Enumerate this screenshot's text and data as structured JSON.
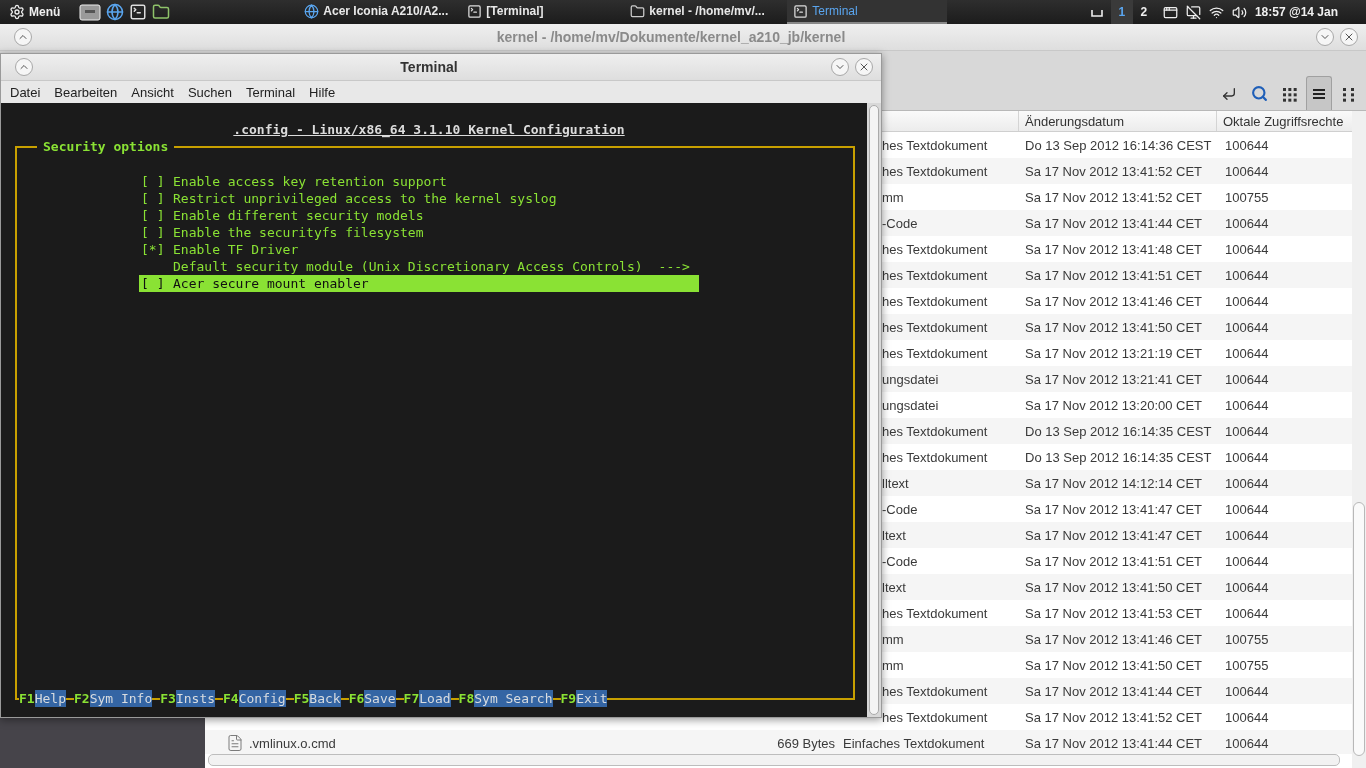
{
  "top_panel": {
    "menu_label": "Menü",
    "tasks": [
      {
        "kind": "browser",
        "label": "Acer Iconia A210/A2...",
        "selected": false
      },
      {
        "kind": "terminal",
        "label": "[Terminal]",
        "selected": false
      },
      {
        "kind": "folder",
        "label": "kernel - /home/mv/...",
        "selected": false
      },
      {
        "kind": "terminal",
        "label": "Terminal",
        "selected": true
      }
    ],
    "workspaces": [
      {
        "label": "1",
        "selected": true
      },
      {
        "label": "2",
        "selected": false
      }
    ],
    "clock": "18:57 @14 Jan"
  },
  "file_manager": {
    "title": "kernel - /home/mv/Dokumente/kernel_a210_jb/kernel",
    "view_buttons": [
      {
        "kind": "icons",
        "selected": false
      },
      {
        "kind": "list",
        "selected": true
      },
      {
        "kind": "compact",
        "selected": false
      }
    ],
    "columns": [
      "Änderungsdatum",
      "Oktale Zugriffsrechte"
    ],
    "rows": [
      {
        "kind": "covered",
        "type": "hes Textdokument",
        "date": "Do 13 Sep 2012 16:14:36 CEST",
        "permissions": "100644"
      },
      {
        "kind": "covered",
        "type": "hes Textdokument",
        "date": "Sa 17 Nov 2012 13:41:52 CET",
        "permissions": "100644"
      },
      {
        "kind": "covered",
        "type": "mm",
        "date": "Sa 17 Nov 2012 13:41:52 CET",
        "permissions": "100755"
      },
      {
        "kind": "covered",
        "type": "-Code",
        "date": "Sa 17 Nov 2012 13:41:44 CET",
        "permissions": "100644"
      },
      {
        "kind": "covered",
        "type": "hes Textdokument",
        "date": "Sa 17 Nov 2012 13:41:48 CET",
        "permissions": "100644"
      },
      {
        "kind": "covered",
        "type": "hes Textdokument",
        "date": "Sa 17 Nov 2012 13:41:51 CET",
        "permissions": "100644"
      },
      {
        "kind": "covered",
        "type": "hes Textdokument",
        "date": "Sa 17 Nov 2012 13:41:46 CET",
        "permissions": "100644"
      },
      {
        "kind": "covered",
        "type": "hes Textdokument",
        "date": "Sa 17 Nov 2012 13:41:50 CET",
        "permissions": "100644"
      },
      {
        "kind": "covered",
        "type": "hes Textdokument",
        "date": "Sa 17 Nov 2012 13:21:19 CET",
        "permissions": "100644"
      },
      {
        "kind": "covered",
        "type": "ungsdatei",
        "date": "Sa 17 Nov 2012 13:21:41 CET",
        "permissions": "100644"
      },
      {
        "kind": "covered",
        "type": "ungsdatei",
        "date": "Sa 17 Nov 2012 13:20:00 CET",
        "permissions": "100644"
      },
      {
        "kind": "covered",
        "type": "hes Textdokument",
        "date": "Do 13 Sep 2012 16:14:35 CEST",
        "permissions": "100644"
      },
      {
        "kind": "covered",
        "type": "hes Textdokument",
        "date": "Do 13 Sep 2012 16:14:35 CEST",
        "permissions": "100644"
      },
      {
        "kind": "covered",
        "type": "lltext",
        "date": "Sa 17 Nov 2012 14:12:14 CET",
        "permissions": "100644"
      },
      {
        "kind": "covered",
        "type": "-Code",
        "date": "Sa 17 Nov 2012 13:41:47 CET",
        "permissions": "100644"
      },
      {
        "kind": "covered",
        "type": "ltext",
        "date": "Sa 17 Nov 2012 13:41:47 CET",
        "permissions": "100644"
      },
      {
        "kind": "covered",
        "type": "-Code",
        "date": "Sa 17 Nov 2012 13:41:51 CET",
        "permissions": "100644"
      },
      {
        "kind": "covered",
        "type": "ltext",
        "date": "Sa 17 Nov 2012 13:41:50 CET",
        "permissions": "100644"
      },
      {
        "kind": "covered",
        "type": "hes Textdokument",
        "date": "Sa 17 Nov 2012 13:41:53 CET",
        "permissions": "100644"
      },
      {
        "kind": "covered",
        "type": "mm",
        "date": "Sa 17 Nov 2012 13:41:46 CET",
        "permissions": "100755"
      },
      {
        "kind": "covered",
        "type": "mm",
        "date": "Sa 17 Nov 2012 13:41:50 CET",
        "permissions": "100755"
      },
      {
        "kind": "covered",
        "type": "hes Textdokument",
        "date": "Sa 17 Nov 2012 13:41:44 CET",
        "permissions": "100644"
      },
      {
        "kind": "covered",
        "type": "hes Textdokument",
        "date": "Sa 17 Nov 2012 13:41:52 CET",
        "permissions": "100644"
      },
      {
        "kind": "full",
        "name": ".vmlinux.o.cmd",
        "size": "669 Bytes",
        "type": "Einfaches Textdokument",
        "date": "Sa 17 Nov 2012 13:41:44 CET",
        "permissions": "100644"
      }
    ]
  },
  "terminal": {
    "title": "Terminal",
    "menu": [
      "Datei",
      "Bearbeiten",
      "Ansicht",
      "Suchen",
      "Terminal",
      "Hilfe"
    ],
    "heading": ".config - Linux/x86_64 3.1.10 Kernel Configuration",
    "section": "Security options",
    "options": [
      {
        "kind": "bool",
        "box": "[ ]",
        "label": "Enable access key retention support",
        "selected": false
      },
      {
        "kind": "bool",
        "box": "[ ]",
        "label": "Restrict unprivileged access to the kernel syslog",
        "selected": false
      },
      {
        "kind": "bool",
        "box": "[ ]",
        "label": "Enable different security models",
        "selected": false
      },
      {
        "kind": "bool",
        "box": "[ ]",
        "label": "Enable the securityfs filesystem",
        "selected": false
      },
      {
        "kind": "bool",
        "box": "[*]",
        "label": "Enable TF Driver",
        "selected": false
      },
      {
        "kind": "choice",
        "label": "Default security module (Unix Discretionary Access Controls)",
        "arrow": "--->",
        "selected": false
      },
      {
        "kind": "bool",
        "box": "[ ]",
        "label": "Acer secure mount enabler",
        "selected": true
      }
    ],
    "function_keys": [
      {
        "key": "F1",
        "label": "Help"
      },
      {
        "key": "F2",
        "label": "Sym Info"
      },
      {
        "key": "F3",
        "label": "Insts"
      },
      {
        "key": "F4",
        "label": "Config"
      },
      {
        "key": "F5",
        "label": "Back"
      },
      {
        "key": "F6",
        "label": "Save"
      },
      {
        "key": "F7",
        "label": "Load"
      },
      {
        "key": "F8",
        "label": "Sym Search"
      },
      {
        "key": "F9",
        "label": "Exit"
      }
    ]
  }
}
